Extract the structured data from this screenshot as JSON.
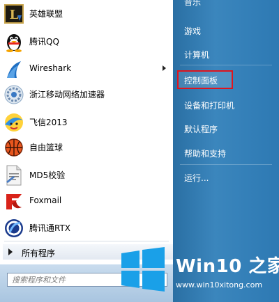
{
  "programs": [
    {
      "label": "英雄联盟",
      "icon": "league-of-legends-icon"
    },
    {
      "label": "腾讯QQ",
      "icon": "qq-penguin-icon"
    },
    {
      "label": "Wireshark",
      "icon": "wireshark-fin-icon",
      "has_submenu": true
    },
    {
      "label": "浙江移动网络加速器",
      "icon": "network-accelerator-icon"
    },
    {
      "label": "飞信2013",
      "icon": "fetion-icon"
    },
    {
      "label": "自由篮球",
      "icon": "basketball-icon"
    },
    {
      "label": "MD5校验",
      "icon": "md5-document-icon"
    },
    {
      "label": "Foxmail",
      "icon": "foxmail-icon"
    },
    {
      "label": "腾讯通RTX",
      "icon": "rtx-icon"
    }
  ],
  "all_programs": "所有程序",
  "search": {
    "placeholder": "搜索程序和文件"
  },
  "right_items": [
    {
      "label": "音乐"
    },
    {
      "label": "游戏"
    },
    {
      "label": "计算机"
    },
    {
      "label": "控制面板",
      "highlighted": true
    },
    {
      "label": "设备和打印机"
    },
    {
      "label": "默认程序"
    },
    {
      "label": "帮助和支持"
    },
    {
      "label": "运行..."
    }
  ],
  "watermark": {
    "title": "Win10 之家",
    "url": "www.win10xitong.com"
  },
  "colors": {
    "highlight_border": "#e0141d",
    "right_panel": "#2f7cb6",
    "logo_blue": "#1aa0e8"
  }
}
